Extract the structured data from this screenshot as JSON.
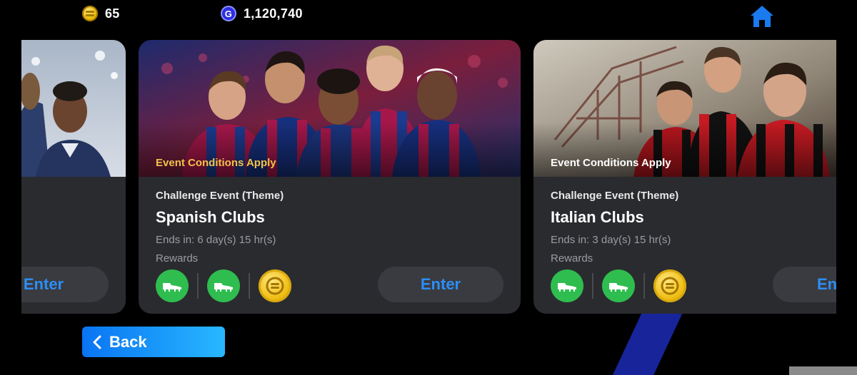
{
  "header": {
    "coins": "65",
    "gp": "1,120,740",
    "gp_icon_letter": "G"
  },
  "cards": [
    {
      "enter_label": "Enter"
    },
    {
      "condition": "Event Conditions Apply",
      "condition_color": "#f2c24a",
      "type": "Challenge Event (Theme)",
      "name": "Spanish Clubs",
      "ends": "Ends in: 6 day(s) 15 hr(s)",
      "rewards_label": "Rewards",
      "rewards": [
        "boots-icon",
        "boots-icon",
        "ecoin-icon"
      ],
      "enter_label": "Enter"
    },
    {
      "condition": "Event Conditions Apply",
      "condition_color": "#ffffff",
      "type": "Challenge Event (Theme)",
      "name": "Italian Clubs",
      "ends": "Ends in: 3 day(s) 15 hr(s)",
      "rewards_label": "Rewards",
      "rewards": [
        "boots-icon",
        "boots-icon",
        "ecoin-icon"
      ],
      "enter_label": "En"
    }
  ],
  "footer": {
    "back_label": "Back"
  },
  "colors": {
    "accent": "#2c8ef5",
    "card_bg": "#2a2b2f",
    "reward_green": "#2fbd4f",
    "coin_gold": "#f0be14"
  }
}
